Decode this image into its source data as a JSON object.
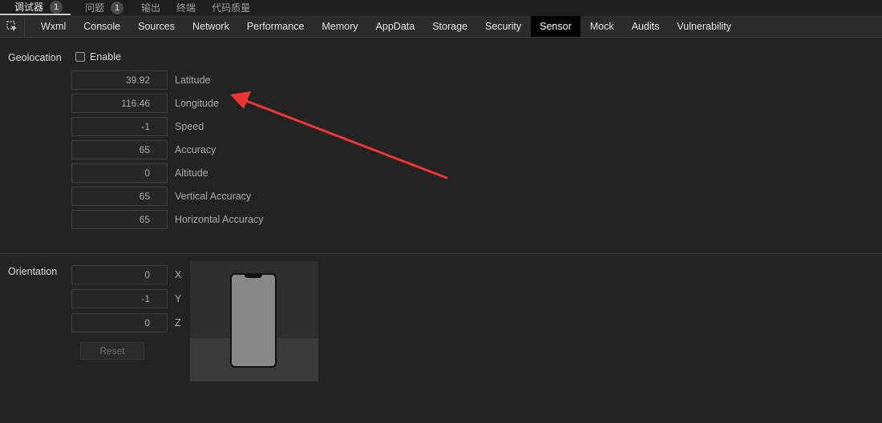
{
  "top_tabs": [
    {
      "label": "调试器",
      "badge": "1"
    },
    {
      "label": "问题",
      "badge": "1"
    },
    {
      "label": "输出"
    },
    {
      "label": "终端"
    },
    {
      "label": "代码质量"
    }
  ],
  "panel_tabs": [
    "Wxml",
    "Console",
    "Sources",
    "Network",
    "Performance",
    "Memory",
    "AppData",
    "Storage",
    "Security",
    "Sensor",
    "Mock",
    "Audits",
    "Vulnerability"
  ],
  "active_panel_tab": "Sensor",
  "geolocation": {
    "title": "Geolocation",
    "enable_label": "Enable",
    "enabled": false,
    "fields": [
      {
        "label": "Latitude",
        "value": "39.92"
      },
      {
        "label": "Longitude",
        "value": "116.46"
      },
      {
        "label": "Speed",
        "value": "-1"
      },
      {
        "label": "Accuracy",
        "value": "65"
      },
      {
        "label": "Altitude",
        "value": "0"
      },
      {
        "label": "Vertical Accuracy",
        "value": "65"
      },
      {
        "label": "Horizontal Accuracy",
        "value": "65"
      }
    ]
  },
  "orientation": {
    "title": "Orientation",
    "fields": [
      {
        "label": "X",
        "value": "0"
      },
      {
        "label": "Y",
        "value": "-1"
      },
      {
        "label": "Z",
        "value": "0"
      }
    ],
    "reset_label": "Reset"
  },
  "annotation_color": "#ee3535"
}
